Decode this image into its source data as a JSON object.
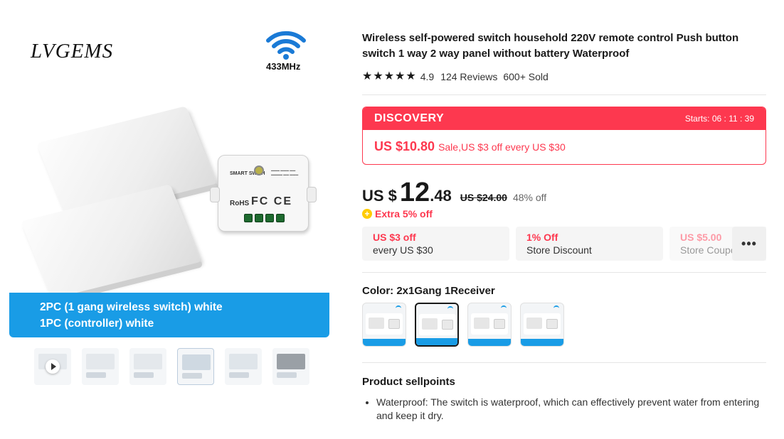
{
  "gallery": {
    "brand": "LVGEMS",
    "freq_badge": "433MHz",
    "receiver_label": "SMART SWITH",
    "receiver_marks": "RoHS",
    "caption_lines": [
      "2PC (1 gang wireless switch)    white",
      "1PC (controller)    white"
    ],
    "thumbnail_count": 6
  },
  "product": {
    "title": "Wireless self-powered switch household 220V remote control Push button switch 1 way 2 way panel without battery Waterproof",
    "rating": "4.9",
    "reviews": "124 Reviews",
    "sold": "600+ Sold",
    "stars": 5
  },
  "promo": {
    "label": "DISCOVERY",
    "starts": "Starts: 06 : 11 : 39",
    "price": "US $10.80",
    "sale_text": "Sale,US $3 off every US $30"
  },
  "price": {
    "currency": "US $",
    "integer": "12",
    "decimal": ".48",
    "original": "US $24.00",
    "discount": "48% off"
  },
  "extra": {
    "text": "Extra 5% off"
  },
  "coupons": [
    {
      "title": "US $3 off",
      "subtitle": "every US $30"
    },
    {
      "title": "1% Off",
      "subtitle": "Store Discount"
    },
    {
      "title": "US $5.00",
      "subtitle": "Store Coupon"
    }
  ],
  "more_label": "•••",
  "color": {
    "label": "Color: 2x1Gang 1Receiver",
    "selected_index": 1,
    "options_count": 4
  },
  "sellpoints": {
    "title": "Product sellpoints",
    "items": [
      "Waterproof: The switch is waterproof, which can effectively prevent water from entering and keep it dry."
    ]
  },
  "colors": {
    "accent_red": "#fd384f",
    "caption_blue": "#199ce6",
    "star": "#191919",
    "coin": "#ffcc00"
  }
}
